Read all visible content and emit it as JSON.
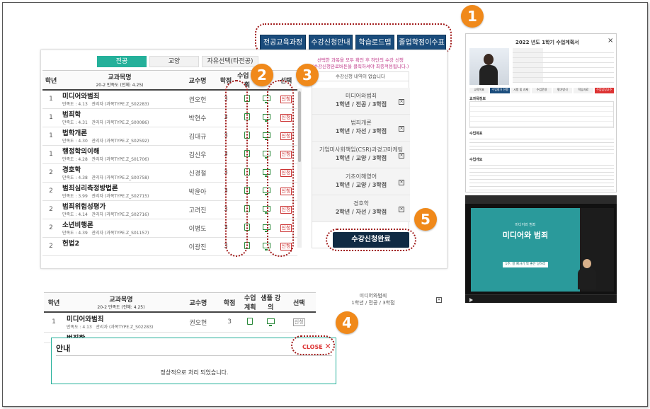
{
  "top_buttons": [
    "전공교육과정",
    "수강신청안내",
    "학습로드맵",
    "졸업학점이수표"
  ],
  "badges": [
    "1",
    "2",
    "3",
    "4",
    "5"
  ],
  "tabs": [
    {
      "label": "전공",
      "active": true
    },
    {
      "label": "교양",
      "active": false
    },
    {
      "label": "자유선택(타전공)",
      "active": false
    }
  ],
  "notice": {
    "line1": "선택한 과목을 모두 확인 후 하단의 수강 신청",
    "line2": "(수강신청완료버튼을 클릭하셔야 최종적용됩니다.)",
    "empty": "수강신청 내역이 없습니다"
  },
  "table": {
    "headers": {
      "year": "학년",
      "course": "교과목명",
      "course_sub": "20-2 만족도 (전체: 4.25)",
      "prof": "교수명",
      "credit": "학점",
      "plan": "수업 계획",
      "lecture": "샘플 강의",
      "select": "선택"
    },
    "rows": [
      {
        "year": "1",
        "name": "미디어와범죄",
        "sat": "만족도 : 4.13",
        "ptype": "관리자 (과목TYPE.Z_S02283)",
        "prof": "권오헌",
        "credit": "3"
      },
      {
        "year": "1",
        "name": "범죄학",
        "sat": "만족도 : 4.31",
        "ptype": "관리자 (과목TYPE.Z_S00086)",
        "prof": "박현수",
        "credit": "3"
      },
      {
        "year": "1",
        "name": "법학개론",
        "sat": "만족도 : 4.30",
        "ptype": "관리자 (과목TYPE.Z_S02592)",
        "prof": "김대규",
        "credit": "3"
      },
      {
        "year": "1",
        "name": "행정학의이해",
        "sat": "만족도 : 4.28",
        "ptype": "관리자 (과목TYPE.Z_S01706)",
        "prof": "김신우",
        "credit": "3"
      },
      {
        "year": "2",
        "name": "경호학",
        "sat": "만족도 : 4.38",
        "ptype": "관리자 (과목TYPE.Z_S00758)",
        "prof": "신경철",
        "credit": "3"
      },
      {
        "year": "2",
        "name": "범죄심리측정방법론",
        "sat": "만족도 : 3.99",
        "ptype": "관리자 (과목TYPE.Z_S02715)",
        "prof": "박윤아",
        "credit": "3"
      },
      {
        "year": "2",
        "name": "범죄위험성평가",
        "sat": "만족도 : 4.14",
        "ptype": "관리자 (과목TYPE.Z_S02716)",
        "prof": "고려진",
        "credit": "3"
      },
      {
        "year": "2",
        "name": "소년비행론",
        "sat": "만족도 : 4.39",
        "ptype": "관리자 (과목TYPE.Z_S01157)",
        "prof": "이병도",
        "credit": "3"
      },
      {
        "year": "2",
        "name": "헌법2",
        "sat": "",
        "ptype": "",
        "prof": "이광진",
        "credit": "3"
      }
    ],
    "select_label": "신청"
  },
  "cart": [
    {
      "name": "미디어와범죄",
      "meta": "1학년 / 전공 / 3학점"
    },
    {
      "name": "범죄개론",
      "meta": "1학년 / 자선 / 3학점"
    },
    {
      "name": "기업미사회책임(CSR)과경고마케팅",
      "meta": "1학년 / 교양 / 3학점"
    },
    {
      "name": "기초이해영어",
      "meta": "1학년 / 교양 / 3학점"
    },
    {
      "name": "경호학",
      "meta": "2학년 / 자선 / 3학점"
    }
  ],
  "submit_label": "수강신청완료",
  "detail": {
    "title": "2022 년도 1학기 수업계획서",
    "close": "×",
    "tabs": [
      "교육목표",
      "수업평가 진행",
      "시험 및 과제",
      "수업운영",
      "평가방식",
      "학습자료",
      "수업담당교수"
    ],
    "section1": "교과목정보",
    "section2": "수업목표",
    "section3": "수업개요"
  },
  "video": {
    "title_small": "미디어와 범죄",
    "title": "미디어와 범죄",
    "caption": "1주. 잘 빠사기 짝 좋은 날하라"
  },
  "bottom": {
    "course_header": "교과목명",
    "course_sub": "20-2 만족도 (전체: 4.25)",
    "row_year": "1",
    "row_name": "미디어와범죄",
    "row_sat": "만족도 : 4.13",
    "row_ptype": "관리자 (과목TYPE.Z_S02283)",
    "row_prof": "권오헌",
    "row_credit": "3",
    "row_select": "신청",
    "row2_name": "범죄학",
    "right_name": "미디어와범죄",
    "right_meta": "1학년 / 전공 / 3학점"
  },
  "modal": {
    "title": "안내",
    "close_label": "CLOSE",
    "message": "정상적으로 처리 되었습니다."
  },
  "colors": {
    "accent_teal": "#24b09a",
    "navy": "#1a4c7c",
    "badge_orange": "#f0891a",
    "highlight_red": "#a11b1b"
  }
}
